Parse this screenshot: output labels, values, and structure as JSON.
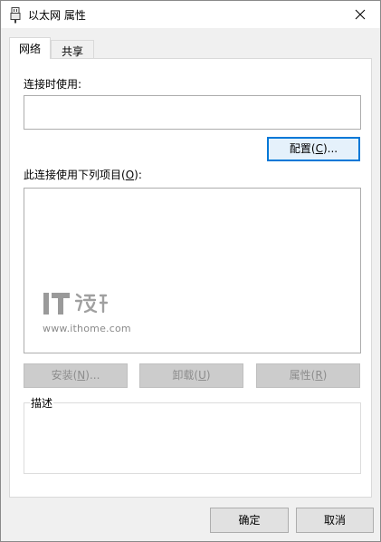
{
  "window": {
    "title": "以太网 属性",
    "icon": "ethernet-adapter-icon",
    "close": "close-icon"
  },
  "tabs": [
    {
      "label": "网络",
      "active": true
    },
    {
      "label": "共享",
      "active": false
    }
  ],
  "network": {
    "connect_using_label": "连接时使用:",
    "adapter_value": "",
    "configure_label_pre": "配置(",
    "configure_key": "C",
    "configure_label_post": ")...",
    "items_label_pre": "此连接使用下列项目(",
    "items_key": "O",
    "items_label_post": "):",
    "items": [],
    "install_pre": "安装(",
    "install_key": "N",
    "install_post": ")...",
    "uninstall_pre": "卸载(",
    "uninstall_key": "U",
    "uninstall_post": ")",
    "properties_pre": "属性(",
    "properties_key": "R",
    "properties_post": ")",
    "description_legend": "描述",
    "description_text": ""
  },
  "watermark": {
    "logo": "ithome-logo-icon",
    "url": "www.ithome.com"
  },
  "footer": {
    "ok_label": "确定",
    "cancel_label": "取消"
  },
  "colors": {
    "focus_accent": "#0078d7",
    "dialog_bg": "#f0f0f0"
  }
}
